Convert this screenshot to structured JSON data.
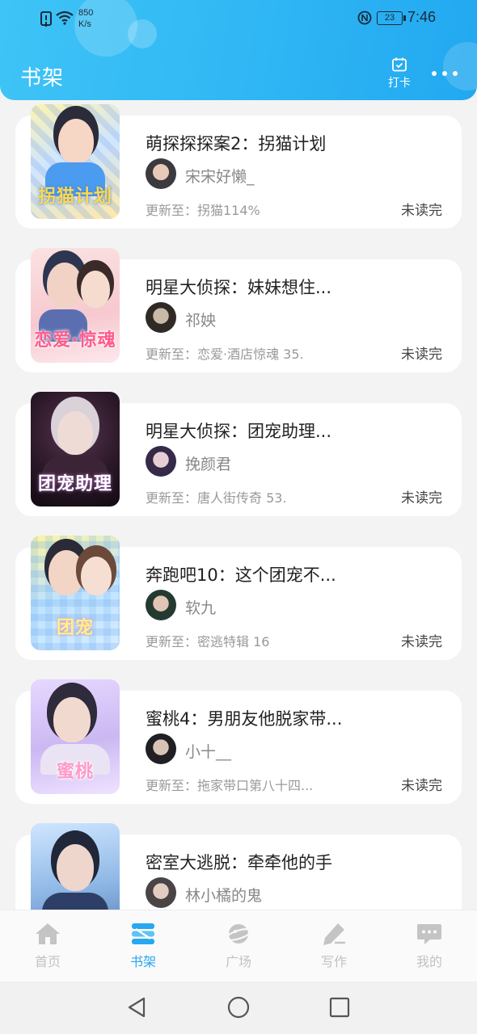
{
  "status_bar": {
    "speed_value": "850",
    "speed_unit": "K/s",
    "battery": "23",
    "time": "7:46"
  },
  "header": {
    "title": "书架",
    "checkin_label": "打卡"
  },
  "books": [
    {
      "title": "萌探探探案2：拐猫计划",
      "author": "宋宋好懒_",
      "update": "更新至：拐猫114%",
      "status": "未读完"
    },
    {
      "title": "明星大侦探：妹妹想住...",
      "author": "祁姎",
      "update": "更新至：恋爱·酒店惊魂 35.",
      "status": "未读完"
    },
    {
      "title": "明星大侦探：团宠助理...",
      "author": "挽颜君",
      "update": "更新至：唐人街传奇 53.",
      "status": "未读完"
    },
    {
      "title": "奔跑吧10：这个团宠不...",
      "author": "软九",
      "update": "更新至：密逃特辑 16",
      "status": "未读完"
    },
    {
      "title": "蜜桃4：男朋友他脱家带...",
      "author": "小十__",
      "update": "更新至：拖家带口第八十四...",
      "status": "未读完"
    },
    {
      "title": "密室大逃脱：牵牵他的手",
      "author": "林小橘的鬼",
      "update": "",
      "status": ""
    }
  ],
  "tabs": [
    {
      "label": "首页",
      "icon": "home-icon"
    },
    {
      "label": "书架",
      "icon": "bookshelf-icon"
    },
    {
      "label": "广场",
      "icon": "planet-icon"
    },
    {
      "label": "写作",
      "icon": "pen-icon"
    },
    {
      "label": "我的",
      "icon": "chat-bubble-icon"
    }
  ],
  "colors": {
    "header_start": "#3fc4f6",
    "header_end": "#22a8f0",
    "active_tab": "#27a8f0",
    "inactive_tab": "#c2c2c2"
  }
}
